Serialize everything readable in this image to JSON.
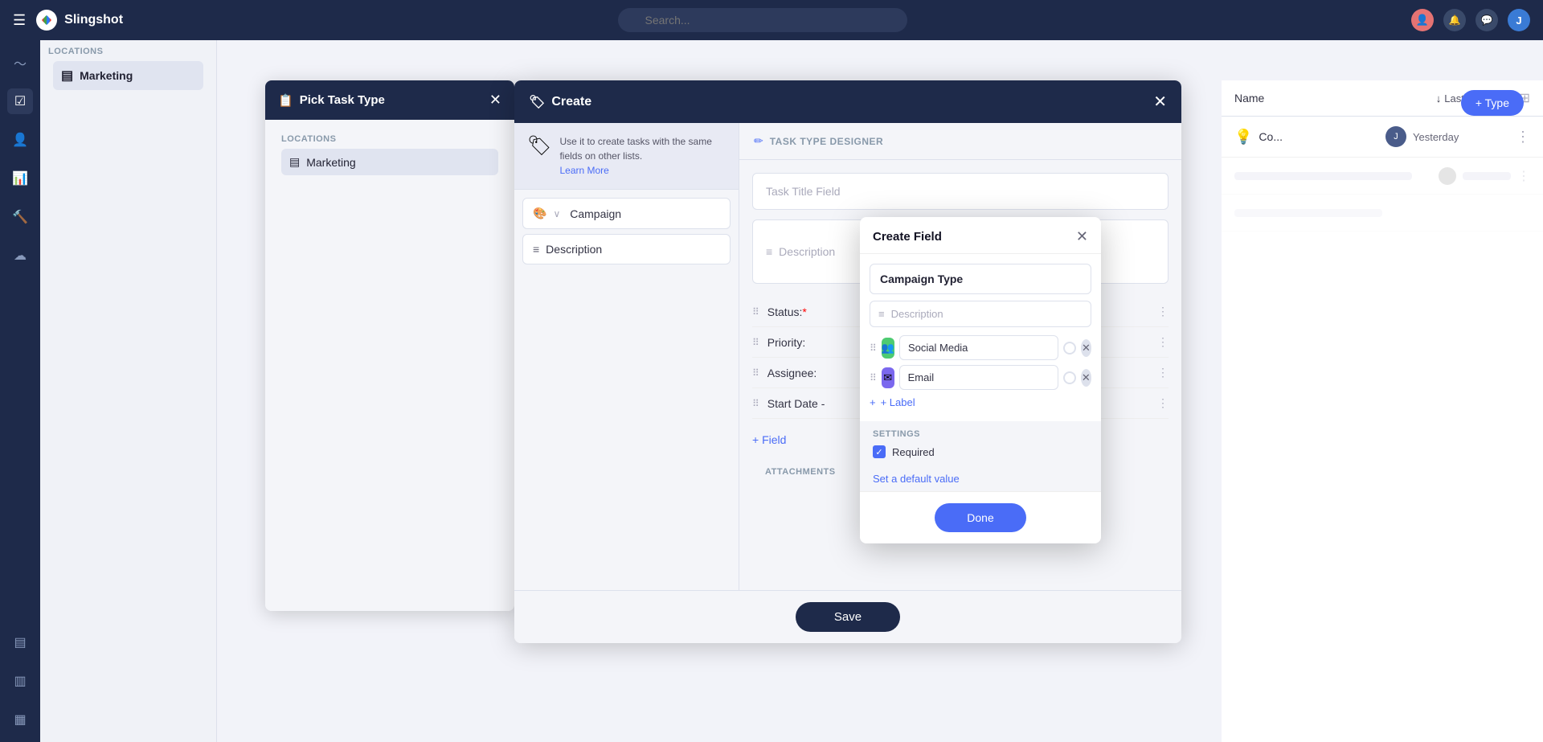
{
  "app": {
    "name": "Slingshot",
    "search_placeholder": "Search..."
  },
  "topbar": {
    "menu_icon": "☰",
    "search_placeholder": "Search..."
  },
  "sidebar": {
    "items": [
      {
        "label": "pulse",
        "icon": "〜",
        "active": false
      },
      {
        "label": "tasks",
        "icon": "☑",
        "active": false
      },
      {
        "label": "people",
        "icon": "👤",
        "active": false
      },
      {
        "label": "analytics",
        "icon": "📊",
        "active": false
      },
      {
        "label": "hammer",
        "icon": "🔨",
        "active": false
      },
      {
        "label": "cloud",
        "icon": "☁",
        "active": false
      },
      {
        "label": "layers",
        "icon": "▤",
        "active": false
      },
      {
        "label": "layers2",
        "icon": "▥",
        "active": false
      },
      {
        "label": "layers3",
        "icon": "▦",
        "active": false
      }
    ]
  },
  "second_sidebar": {
    "locations_label": "LOCATIONS",
    "items": [
      {
        "label": "Marketing",
        "icon": "▤",
        "active": true
      }
    ]
  },
  "bg_table": {
    "header_name": "Name",
    "last_modified_label": "Last Modified",
    "rows": [
      {
        "avatar_text": "J",
        "time": "Yesterday"
      }
    ],
    "type_button": "+ Type",
    "row_name": "Co..."
  },
  "pick_task": {
    "title": "Pick Task Type",
    "title_icon": "📋",
    "close_icon": "✕"
  },
  "create_dialog": {
    "title": "Create",
    "title_icon": "🏷",
    "close_icon": "✕",
    "info_text": "Use it to create tasks with the same fields on other lists.",
    "learn_more": "Learn More",
    "field1_label": "Campaign",
    "field2_label": "Description",
    "designer_title": "TASK TYPE DESIGNER",
    "task_title_placeholder": "Task Title Field",
    "description_placeholder": "Description",
    "fields": [
      {
        "label": "Status:",
        "required": true
      },
      {
        "label": "Priority:"
      },
      {
        "label": "Assignee:"
      },
      {
        "label": "Start Date -"
      }
    ],
    "add_field_label": "+ Field",
    "attachments_label": "ATTACHMENTS",
    "save_label": "Save"
  },
  "create_field_dialog": {
    "title": "Create Field",
    "close_icon": "✕",
    "field_name": "Campaign Type",
    "description_placeholder": "Description",
    "options": [
      {
        "label": "Social Media",
        "icon": "👥",
        "icon_type": "social"
      },
      {
        "label": "Email",
        "icon": "✉",
        "icon_type": "email"
      }
    ],
    "add_label_text": "+ Label",
    "settings_title": "SETTINGS",
    "required_label": "Required",
    "required_checked": true,
    "default_value_label": "Set a default value",
    "done_label": "Done"
  }
}
